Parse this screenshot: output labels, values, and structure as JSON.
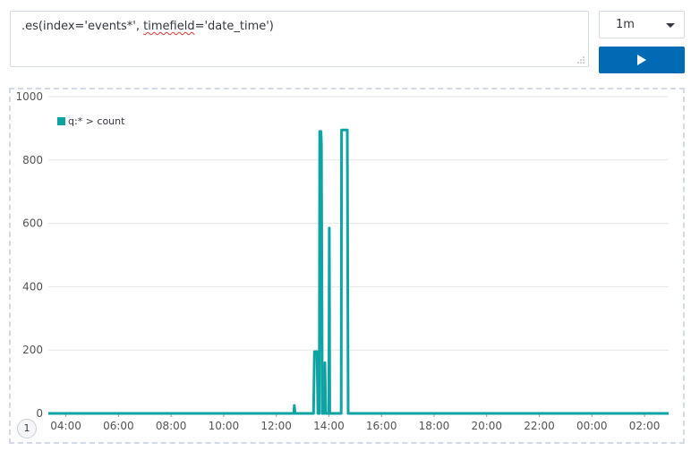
{
  "expression": {
    "prefix": ".es(index='events*', ",
    "underlined": "timefield",
    "suffix": "='date_time')"
  },
  "interval": {
    "value": "1m"
  },
  "run_button": {
    "icon": "play-icon"
  },
  "badge": {
    "text": "1"
  },
  "colors": {
    "series": "#0ea4a4",
    "accent": "#006bb4",
    "grid": "#e6e6e6"
  },
  "chart_data": {
    "type": "line",
    "series": [
      {
        "name": "q:* > count",
        "points": [
          [
            "03:20",
            0
          ],
          [
            "12:40",
            0
          ],
          [
            "12:41",
            25
          ],
          [
            "12:43",
            0
          ],
          [
            "13:25",
            0
          ],
          [
            "13:27",
            195
          ],
          [
            "13:33",
            195
          ],
          [
            "13:35",
            0
          ],
          [
            "13:38",
            0
          ],
          [
            "13:39",
            890
          ],
          [
            "13:42",
            890
          ],
          [
            "13:43",
            850
          ],
          [
            "13:45",
            0
          ],
          [
            "13:50",
            0
          ],
          [
            "13:51",
            160
          ],
          [
            "13:53",
            0
          ],
          [
            "14:00",
            0
          ],
          [
            "14:01",
            585
          ],
          [
            "14:02",
            0
          ],
          [
            "14:28",
            0
          ],
          [
            "14:29",
            895
          ],
          [
            "14:42",
            895
          ],
          [
            "14:44",
            0
          ],
          [
            "26:55",
            0
          ]
        ]
      }
    ],
    "x_ticks": [
      "04:00",
      "06:00",
      "08:00",
      "10:00",
      "12:00",
      "14:00",
      "16:00",
      "18:00",
      "20:00",
      "22:00",
      "00:00",
      "02:00"
    ],
    "y_ticks": [
      0,
      200,
      400,
      600,
      800,
      1000
    ],
    "ylim": [
      0,
      1000
    ],
    "legend": "top-left",
    "grid": true
  }
}
